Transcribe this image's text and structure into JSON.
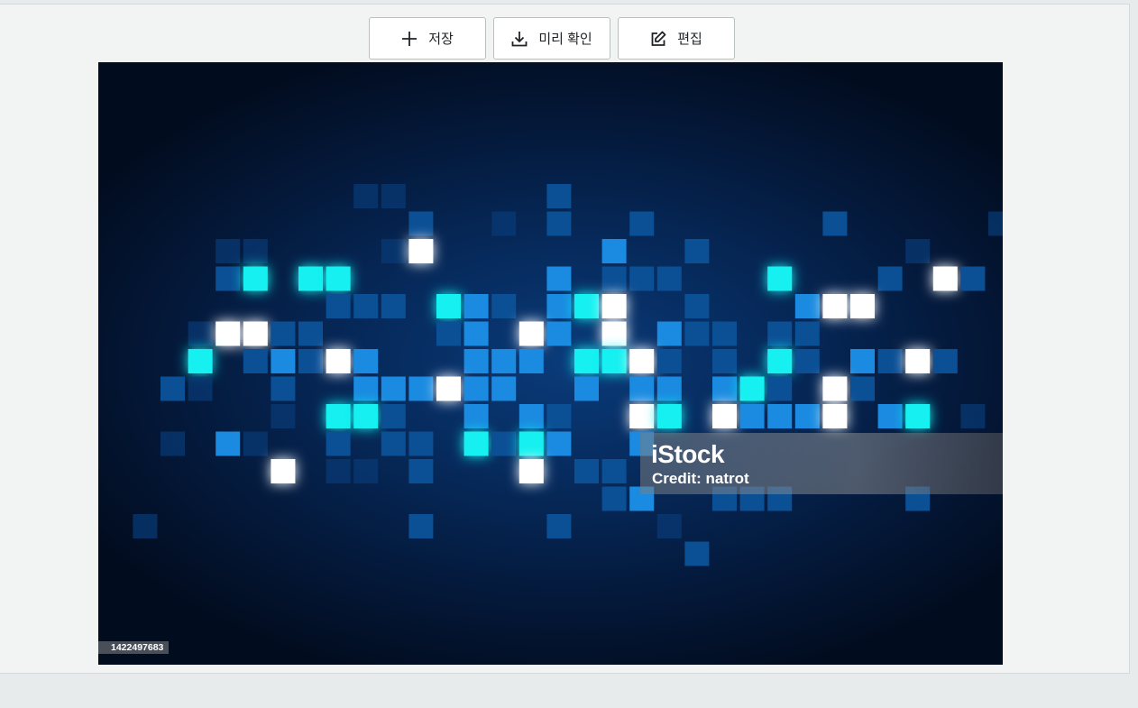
{
  "toolbar": {
    "save_label": "저장",
    "preview_label": "미리 확인",
    "edit_label": "편집"
  },
  "image": {
    "watermark_logo": "iStock",
    "watermark_credit": "Credit: natrot",
    "image_id": "1422497683"
  },
  "colors": {
    "tile_white": "#ffffff",
    "tile_cyan": "#18f0f0",
    "tile_blue": "#1a8be0",
    "tile_dark": "#0b4f95"
  }
}
